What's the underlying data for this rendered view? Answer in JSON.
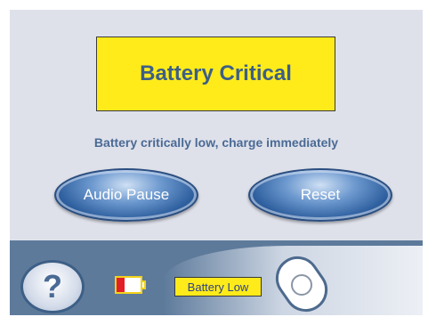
{
  "alarm": {
    "title": "Battery Critical",
    "message": "Battery critically low, charge immediately"
  },
  "buttons": {
    "audio_pause": "Audio Pause",
    "reset": "Reset"
  },
  "footer": {
    "help_label": "?",
    "battery_status": "Battery Low",
    "battery_icon": "battery-low-icon",
    "dial_icon": "rotary-knob-icon"
  },
  "colors": {
    "alarm_yellow": "#ffeb1a",
    "text_blue": "#3d5f86",
    "button_blue": "#2e5f9e",
    "footer_blue": "#5d7a9b",
    "battery_red": "#e21f26"
  }
}
